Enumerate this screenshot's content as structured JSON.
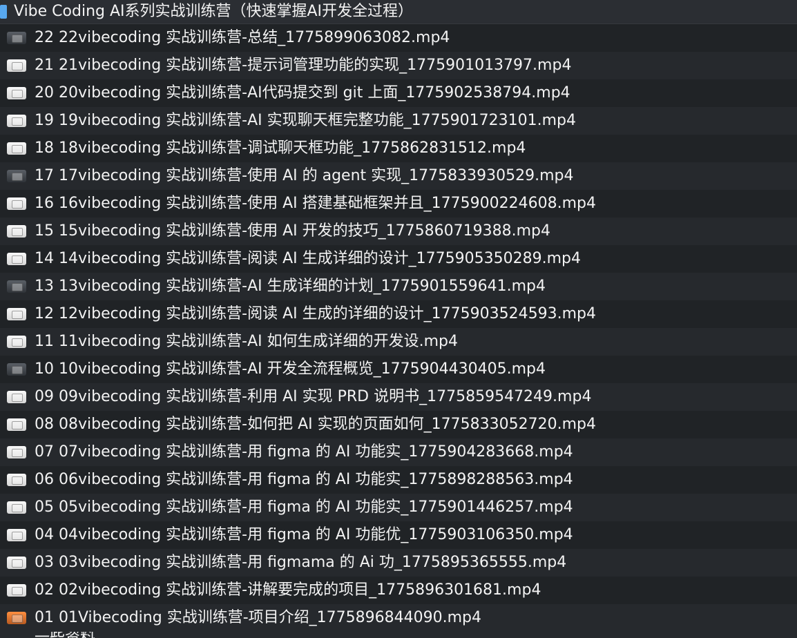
{
  "window": {
    "folder_title": "Vibe Coding AI系列实战训练营（快速掌握AI开发全过程）"
  },
  "files": [
    {
      "name": "22 22vibecoding 实战训练营-总结_1775899063082.mp4",
      "icon": "video-thumbnail-icon",
      "tone": "dark"
    },
    {
      "name": "21 21vibecoding 实战训练营-提示词管理功能的实现_1775901013797.mp4",
      "icon": "video-thumbnail-icon",
      "tone": "light"
    },
    {
      "name": "20 20vibecoding 实战训练营-AI代码提交到 git 上面_1775902538794.mp4",
      "icon": "video-thumbnail-icon",
      "tone": "light"
    },
    {
      "name": "19 19vibecoding 实战训练营-AI 实现聊天框完整功能_1775901723101.mp4",
      "icon": "video-thumbnail-icon",
      "tone": "light"
    },
    {
      "name": "18 18vibecoding 实战训练营-调试聊天框功能_1775862831512.mp4",
      "icon": "video-thumbnail-icon",
      "tone": "light"
    },
    {
      "name": "17 17vibecoding 实战训练营-使用 AI 的 agent 实现_1775833930529.mp4",
      "icon": "video-thumbnail-icon",
      "tone": "dark"
    },
    {
      "name": "16 16vibecoding 实战训练营-使用 AI 搭建基础框架并且_1775900224608.mp4",
      "icon": "video-thumbnail-icon",
      "tone": "light"
    },
    {
      "name": "15 15vibecoding 实战训练营-使用 AI 开发的技巧_1775860719388.mp4",
      "icon": "video-thumbnail-icon",
      "tone": "light"
    },
    {
      "name": "14 14vibecoding 实战训练营-阅读 AI 生成详细的设计_1775905350289.mp4",
      "icon": "video-thumbnail-icon",
      "tone": "light"
    },
    {
      "name": "13 13vibecoding 实战训练营-AI 生成详细的计划_1775901559641.mp4",
      "icon": "video-thumbnail-icon",
      "tone": "dark"
    },
    {
      "name": "12 12vibecoding 实战训练营-阅读 AI 生成的详细的设计_1775903524593.mp4",
      "icon": "video-thumbnail-icon",
      "tone": "light"
    },
    {
      "name": "11 11vibecoding 实战训练营-AI 如何生成详细的开发设.mp4",
      "icon": "video-thumbnail-icon",
      "tone": "light"
    },
    {
      "name": "10 10vibecoding 实战训练营-AI 开发全流程概览_1775904430405.mp4",
      "icon": "video-thumbnail-icon",
      "tone": "dark"
    },
    {
      "name": "09 09vibecoding 实战训练营-利用 AI 实现 PRD 说明书_1775859547249.mp4",
      "icon": "video-thumbnail-icon",
      "tone": "light"
    },
    {
      "name": "08 08vibecoding 实战训练营-如何把 AI 实现的页面如何_1775833052720.mp4",
      "icon": "video-thumbnail-icon",
      "tone": "light"
    },
    {
      "name": "07 07vibecoding 实战训练营-用 figma 的 AI 功能实_1775904283668.mp4",
      "icon": "video-thumbnail-icon",
      "tone": "light"
    },
    {
      "name": "06 06vibecoding 实战训练营-用 figma 的 AI 功能实_1775898288563.mp4",
      "icon": "video-thumbnail-icon",
      "tone": "light"
    },
    {
      "name": "05 05vibecoding 实战训练营-用 figma 的 AI 功能实_1775901446257.mp4",
      "icon": "video-thumbnail-icon",
      "tone": "light"
    },
    {
      "name": "04 04vibecoding 实战训练营-用 figma 的 AI 功能优_1775903106350.mp4",
      "icon": "video-thumbnail-icon",
      "tone": "light"
    },
    {
      "name": "03 03vibecoding 实战训练营-用 figmama 的 Ai 功_1775895365555.mp4",
      "icon": "video-thumbnail-icon",
      "tone": "light"
    },
    {
      "name": "02 02vibecoding 实战训练营-讲解要完成的项目_1775896301681.mp4",
      "icon": "video-thumbnail-icon",
      "tone": "light"
    },
    {
      "name": "01 01Vibecoding 实战训练营-项目介绍_1775896844090.mp4",
      "icon": "video-thumbnail-icon",
      "tone": "orange"
    }
  ],
  "partial_item": {
    "name": "一些资料"
  }
}
